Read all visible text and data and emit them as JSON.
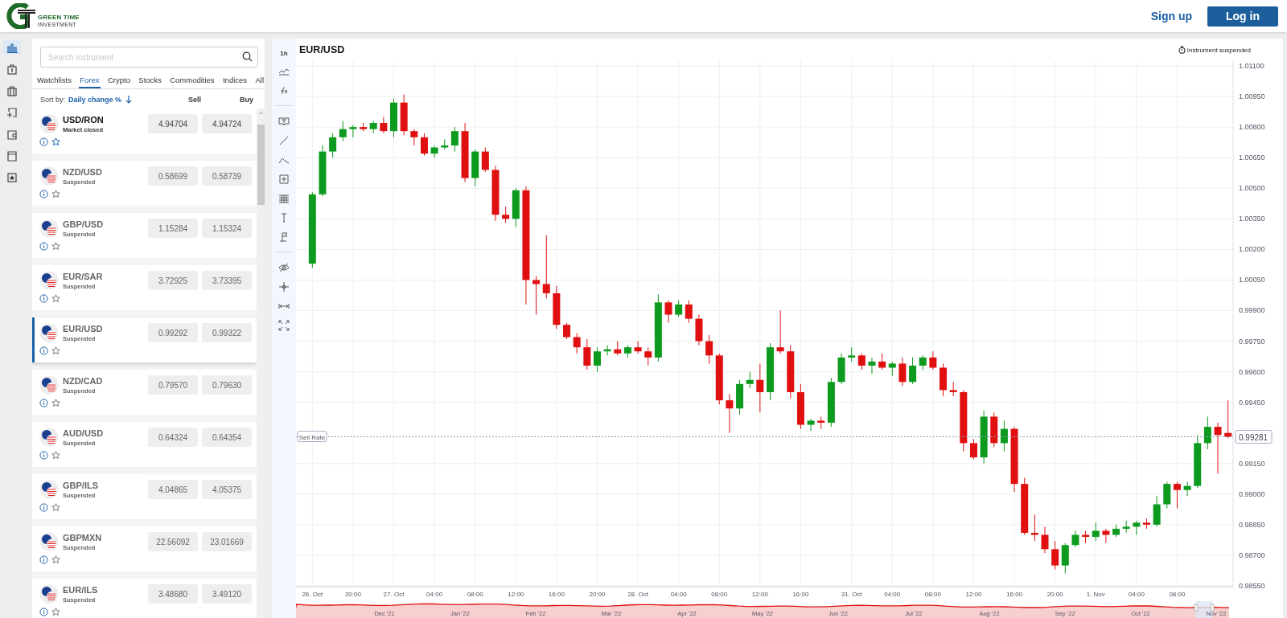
{
  "header": {
    "brand": "GREEN TIME",
    "tagline": "INVESTMENT",
    "sign_up": "Sign up",
    "log_in": "Log in"
  },
  "rail": [
    {
      "kind": "chart",
      "selected": true
    },
    {
      "kind": "bag",
      "selected": false
    },
    {
      "kind": "briefcase",
      "selected": false
    },
    {
      "kind": "deposit",
      "selected": false
    },
    {
      "kind": "wallet",
      "selected": false
    },
    {
      "kind": "news",
      "selected": false
    },
    {
      "kind": "favorites",
      "selected": false
    }
  ],
  "instruments": {
    "search": {
      "placeholder": "Search instrument"
    },
    "tabs": [
      {
        "label": "Watchlists",
        "selected": false
      },
      {
        "label": "Forex",
        "selected": true
      },
      {
        "label": "Crypto",
        "selected": false
      },
      {
        "label": "Stocks",
        "selected": false
      },
      {
        "label": "Commodities",
        "selected": false
      },
      {
        "label": "Indices",
        "selected": false
      },
      {
        "label": "All",
        "selected": false
      }
    ],
    "sort": {
      "label": "Sort by:",
      "value": "Daily change %"
    },
    "columns": [
      "Sell",
      "Buy"
    ],
    "items": [
      {
        "name": "USD/RON",
        "status": "Market closed",
        "suspended": false,
        "sell": "4.94704",
        "buy": "4.94724",
        "selected": false
      },
      {
        "name": "NZD/USD",
        "status": "Suspended",
        "suspended": true,
        "sell": "0.58699",
        "buy": "0.58739",
        "selected": false
      },
      {
        "name": "GBP/USD",
        "status": "Suspended",
        "suspended": true,
        "sell": "1.15284",
        "buy": "1.15324",
        "selected": false
      },
      {
        "name": "EUR/SAR",
        "status": "Suspended",
        "suspended": true,
        "sell": "3.72925",
        "buy": "3.73395",
        "selected": false
      },
      {
        "name": "EUR/USD",
        "status": "Suspended",
        "suspended": true,
        "sell": "0.99292",
        "buy": "0.99322",
        "selected": true
      },
      {
        "name": "NZD/CAD",
        "status": "Suspended",
        "suspended": true,
        "sell": "0.79570",
        "buy": "0.79630",
        "selected": false
      },
      {
        "name": "AUD/USD",
        "status": "Suspended",
        "suspended": true,
        "sell": "0.64324",
        "buy": "0.64354",
        "selected": false
      },
      {
        "name": "GBP/ILS",
        "status": "Suspended",
        "suspended": true,
        "sell": "4.04865",
        "buy": "4.05375",
        "selected": false
      },
      {
        "name": "GBPMXN",
        "status": "Suspended",
        "suspended": true,
        "sell": "22.56092",
        "buy": "23.01669",
        "selected": false
      },
      {
        "name": "EUR/ILS",
        "status": "Suspended",
        "suspended": true,
        "sell": "3.48680",
        "buy": "3.49120",
        "selected": false
      }
    ]
  },
  "chart": {
    "title": "EUR/USD",
    "notice": "Instrument suspended",
    "timeframe": "1h",
    "tool_groups": [
      [
        {
          "kind": "area"
        },
        {
          "kind": "function"
        }
      ],
      [
        {
          "kind": "text"
        },
        {
          "kind": "line"
        },
        {
          "kind": "path"
        },
        {
          "kind": "box"
        },
        {
          "kind": "grid"
        },
        {
          "kind": "pin"
        },
        {
          "kind": "flag"
        }
      ],
      [
        {
          "kind": "eye"
        },
        {
          "kind": "crosshair"
        },
        {
          "kind": "range"
        },
        {
          "kind": "expand"
        }
      ]
    ],
    "current_price": "0.99281",
    "chart_data": {
      "type": "candlestick",
      "ylim": [
        0.9855,
        1.011
      ],
      "grid": true,
      "ref_lines": [
        {
          "axis": "y",
          "value": 0.99281,
          "label": "Sell Rate"
        }
      ],
      "categories": [
        "26. Oct",
        null,
        null,
        null,
        "20:00",
        null,
        null,
        null,
        "27. Oct",
        null,
        null,
        null,
        "04:00",
        null,
        null,
        null,
        "08:00",
        null,
        null,
        null,
        "12:00",
        null,
        null,
        null,
        "16:00",
        null,
        null,
        null,
        "20:00",
        null,
        null,
        null,
        "28. Oct",
        null,
        null,
        null,
        "04:00",
        null,
        null,
        null,
        "08:00",
        null,
        null,
        null,
        "12:00",
        null,
        null,
        null,
        "16:00",
        null,
        null,
        null,
        null,
        "31. Oct",
        null,
        null,
        null,
        "04:00",
        null,
        null,
        null,
        "08:00",
        null,
        null,
        null,
        "12:00",
        null,
        null,
        null,
        "16:00",
        null,
        null,
        null,
        "20:00",
        null,
        null,
        null,
        "1. Nov",
        null,
        null,
        null,
        "04:00",
        null,
        null,
        null,
        "08:00",
        null,
        null,
        null,
        null,
        null
      ],
      "ohlc": [
        [
          1.0013,
          1.0048,
          1.0011,
          1.0047
        ],
        [
          1.0047,
          1.0071,
          1.0046,
          1.0068
        ],
        [
          1.0068,
          1.0077,
          1.0065,
          1.0075
        ],
        [
          1.0075,
          1.0083,
          1.0073,
          1.0079
        ],
        [
          1.0079,
          1.0081,
          1.0075,
          1.008
        ],
        [
          1.008,
          1.0082,
          1.0078,
          1.0079
        ],
        [
          1.0079,
          1.0083,
          1.0077,
          1.0082
        ],
        [
          1.0082,
          1.0085,
          1.0077,
          1.0078
        ],
        [
          1.0078,
          1.0094,
          1.0075,
          1.0092
        ],
        [
          1.0092,
          1.0096,
          1.0076,
          1.0078
        ],
        [
          1.0078,
          1.0079,
          1.0071,
          1.0075
        ],
        [
          1.0075,
          1.0077,
          1.0066,
          1.0067
        ],
        [
          1.0067,
          1.0071,
          1.0065,
          1.007
        ],
        [
          1.007,
          1.0074,
          1.0069,
          1.0071
        ],
        [
          1.0071,
          1.008,
          1.0068,
          1.0078
        ],
        [
          1.0078,
          1.0082,
          1.0053,
          1.0055
        ],
        [
          1.0055,
          1.0069,
          1.0051,
          1.0068
        ],
        [
          1.0068,
          1.007,
          1.0058,
          1.0059
        ],
        [
          1.0059,
          1.0061,
          1.0034,
          1.0037
        ],
        [
          1.0037,
          1.0041,
          1.0033,
          1.0035
        ],
        [
          1.0035,
          1.005,
          1.0031,
          1.0049
        ],
        [
          1.0049,
          1.0051,
          0.9993,
          1.0005
        ],
        [
          1.0005,
          1.0007,
          0.9988,
          1.0003
        ],
        [
          1.0003,
          1.0027,
          0.9996,
          0.99985
        ],
        [
          0.99985,
          1.0002,
          0.9981,
          0.9983
        ],
        [
          0.9983,
          0.9984,
          0.9976,
          0.9977
        ],
        [
          0.9977,
          0.9979,
          0.9969,
          0.9972
        ],
        [
          0.9972,
          0.9976,
          0.9961,
          0.9963
        ],
        [
          0.9963,
          0.9972,
          0.996,
          0.997
        ],
        [
          0.997,
          0.9973,
          0.9968,
          0.9971
        ],
        [
          0.9971,
          0.9975,
          0.9968,
          0.9969
        ],
        [
          0.9969,
          0.9973,
          0.9967,
          0.9972
        ],
        [
          0.9972,
          0.9975,
          0.9969,
          0.997
        ],
        [
          0.997,
          0.9972,
          0.9963,
          0.9967
        ],
        [
          0.9967,
          0.9998,
          0.9965,
          0.9994
        ],
        [
          0.9994,
          0.9995,
          0.9984,
          0.9988
        ],
        [
          0.9988,
          0.9995,
          0.9987,
          0.9993
        ],
        [
          0.9993,
          0.9995,
          0.9984,
          0.9986
        ],
        [
          0.9986,
          0.9988,
          0.9973,
          0.9975
        ],
        [
          0.9975,
          0.9978,
          0.9964,
          0.9968
        ],
        [
          0.9968,
          0.9969,
          0.9944,
          0.9946
        ],
        [
          0.9946,
          0.9949,
          0.993,
          0.9942
        ],
        [
          0.9942,
          0.9956,
          0.9939,
          0.9954
        ],
        [
          0.9954,
          0.996,
          0.9952,
          0.9956
        ],
        [
          0.9956,
          0.9964,
          0.994,
          0.995
        ],
        [
          0.995,
          0.9974,
          0.9946,
          0.9972
        ],
        [
          0.9972,
          0.999,
          0.9969,
          0.997
        ],
        [
          0.997,
          0.9973,
          0.9947,
          0.995
        ],
        [
          0.995,
          0.9954,
          0.9932,
          0.9934
        ],
        [
          0.9934,
          0.9937,
          0.9931,
          0.9936
        ],
        [
          0.9936,
          0.9938,
          0.9932,
          0.9935
        ],
        [
          0.9935,
          0.9957,
          0.9933,
          0.9955
        ],
        [
          0.9955,
          0.9969,
          0.9954,
          0.9967
        ],
        [
          0.9967,
          0.9972,
          0.9965,
          0.9968
        ],
        [
          0.9968,
          0.9969,
          0.9961,
          0.9963
        ],
        [
          0.9963,
          0.9967,
          0.9959,
          0.9965
        ],
        [
          0.9965,
          0.9969,
          0.9961,
          0.9962
        ],
        [
          0.9962,
          0.9965,
          0.9958,
          0.9964
        ],
        [
          0.9964,
          0.9967,
          0.9953,
          0.9955
        ],
        [
          0.9955,
          0.9967,
          0.9954,
          0.9963
        ],
        [
          0.9963,
          0.9968,
          0.9961,
          0.9967
        ],
        [
          0.9967,
          0.997,
          0.9961,
          0.9962
        ],
        [
          0.9962,
          0.9964,
          0.9948,
          0.9951
        ],
        [
          0.9951,
          0.9955,
          0.9948,
          0.995
        ],
        [
          0.995,
          0.9951,
          0.9921,
          0.9925
        ],
        [
          0.9925,
          0.9927,
          0.9917,
          0.9918
        ],
        [
          0.9918,
          0.9941,
          0.9915,
          0.9938
        ],
        [
          0.9938,
          0.994,
          0.9923,
          0.9925
        ],
        [
          0.9925,
          0.9936,
          0.9921,
          0.9932
        ],
        [
          0.9932,
          0.9933,
          0.9901,
          0.9905
        ],
        [
          0.9905,
          0.9908,
          0.988,
          0.9881
        ],
        [
          0.9881,
          0.989,
          0.9877,
          0.988
        ],
        [
          0.988,
          0.9884,
          0.9871,
          0.9873
        ],
        [
          0.9873,
          0.9877,
          0.9863,
          0.9865
        ],
        [
          0.9865,
          0.9876,
          0.9861,
          0.9875
        ],
        [
          0.9875,
          0.9882,
          0.9874,
          0.988
        ],
        [
          0.988,
          0.9882,
          0.9876,
          0.9879
        ],
        [
          0.9879,
          0.9886,
          0.9877,
          0.9882
        ],
        [
          0.9882,
          0.9883,
          0.9876,
          0.988
        ],
        [
          0.988,
          0.9885,
          0.9879,
          0.9883
        ],
        [
          0.9883,
          0.9887,
          0.9881,
          0.9884
        ],
        [
          0.9884,
          0.9887,
          0.988,
          0.9886
        ],
        [
          0.9886,
          0.9888,
          0.9883,
          0.9885
        ],
        [
          0.9885,
          0.9899,
          0.9884,
          0.9895
        ],
        [
          0.9895,
          0.9906,
          0.9893,
          0.9905
        ],
        [
          0.9905,
          0.9906,
          0.9893,
          0.9902
        ],
        [
          0.9902,
          0.9906,
          0.9899,
          0.9904
        ],
        [
          0.9904,
          0.9929,
          0.9903,
          0.9925
        ],
        [
          0.9925,
          0.9938,
          0.9922,
          0.9933
        ],
        [
          0.9933,
          0.9935,
          0.991,
          0.9929
        ],
        [
          0.993,
          0.9946,
          0.99275,
          0.99281
        ]
      ],
      "yticks": [
        {
          "value": 1.011,
          "label": "1.01100"
        },
        {
          "value": 1.0095,
          "label": "1.00950"
        },
        {
          "value": 1.008,
          "label": "1.00800"
        },
        {
          "value": 1.0065,
          "label": "1.00650"
        },
        {
          "value": 1.005,
          "label": "1.00500"
        },
        {
          "value": 1.0035,
          "label": "1.00350"
        },
        {
          "value": 1.002,
          "label": "1.00200"
        },
        {
          "value": 1.0005,
          "label": "1.00050"
        },
        {
          "value": 0.999,
          "label": "0.99900"
        },
        {
          "value": 0.9975,
          "label": "0.99750"
        },
        {
          "value": 0.996,
          "label": "0.99600"
        },
        {
          "value": 0.9945,
          "label": "0.99450"
        },
        {
          "value": 0.9915,
          "label": "0.99150"
        },
        {
          "value": 0.99,
          "label": "0.99000"
        },
        {
          "value": 0.9885,
          "label": "0.98850"
        },
        {
          "value": 0.987,
          "label": "0.98700"
        },
        {
          "value": 0.9855,
          "label": "0.98550"
        }
      ]
    },
    "navigator": {
      "labels": [
        "Dec '21",
        "Jan '22",
        "Feb '22",
        "Mar '22",
        "Apr '22",
        "May '22",
        "Jun '22",
        "Jul '22",
        "Aug '22",
        "Sep '22",
        "Oct '22",
        "Nov '22"
      ]
    }
  }
}
